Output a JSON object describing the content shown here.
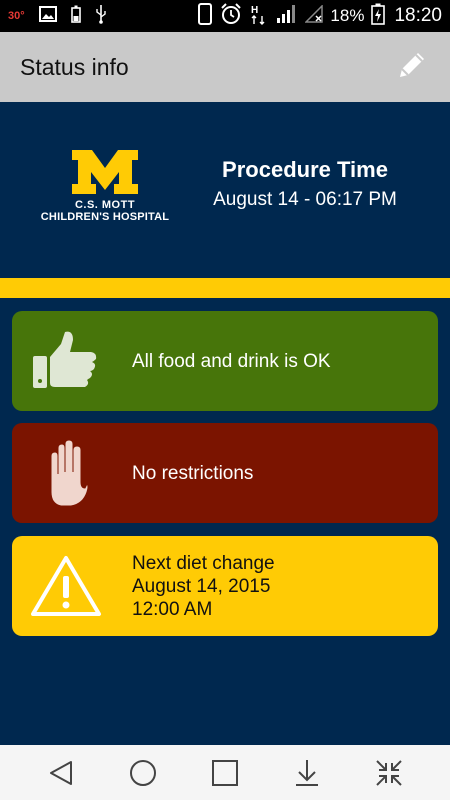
{
  "status_bar": {
    "temperature": "30°",
    "battery_percent": "18%",
    "time": "18:20",
    "icons": [
      "image-icon",
      "battery-small-icon",
      "usb-icon",
      "phone-outline-icon",
      "alarm-icon",
      "hplus-signal-icon",
      "signal-bars-icon",
      "wifi-off-icon",
      "battery-charging-icon"
    ]
  },
  "app_bar": {
    "title": "Status info",
    "edit_icon": "pencil-icon"
  },
  "header": {
    "logo_line1": "C.S. MOTT",
    "logo_line2": "CHILDREN'S HOSPITAL",
    "procedure_title": "Procedure Time",
    "procedure_time": "August 14 - 06:17 PM"
  },
  "cards": [
    {
      "icon": "thumbs-up-icon",
      "text": "All food and drink is OK",
      "color": "#47750a"
    },
    {
      "icon": "stop-hand-icon",
      "text": "No restrictions",
      "color": "#7b1400"
    },
    {
      "icon": "warning-icon",
      "line1": "Next diet change",
      "line2": "August 14, 2015",
      "line3": "12:00 AM",
      "color": "#ffcb05"
    }
  ],
  "nav_bar": {
    "icons": [
      "back-icon",
      "home-icon",
      "recents-icon",
      "download-icon",
      "collapse-icon"
    ]
  },
  "colors": {
    "navy": "#00284f",
    "maize": "#ffcb05"
  }
}
